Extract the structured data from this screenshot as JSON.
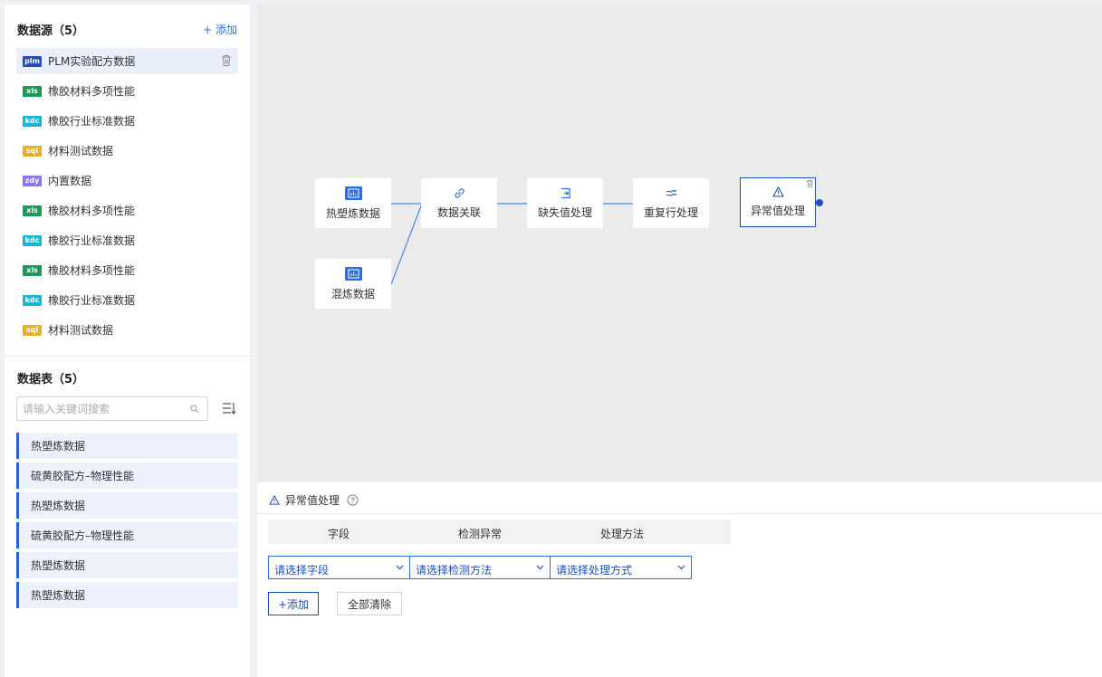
{
  "colors": {
    "accent": "#2a6fdb",
    "node_selected": "#1f4fb8",
    "badge_plm": "#1f4fb8",
    "badge_xls": "#1a9a55",
    "badge_kdc": "#1bb5d8",
    "badge_sql": "#e8b12c",
    "badge_zdy": "#8e74e8"
  },
  "datasource": {
    "title": "数据源（5）",
    "add_label": "+ 添加",
    "items": [
      {
        "badge": "plm",
        "label": "PLM实验配方数据"
      },
      {
        "badge": "xls",
        "label": "橡胶材料多项性能"
      },
      {
        "badge": "kdc",
        "label": "橡胶行业标准数据"
      },
      {
        "badge": "sql",
        "label": "材料测试数据"
      },
      {
        "badge": "zdy",
        "label": "内置数据"
      },
      {
        "badge": "xls",
        "label": "橡胶材料多项性能"
      },
      {
        "badge": "kdc",
        "label": "橡胶行业标准数据"
      },
      {
        "badge": "xls",
        "label": "橡胶材料多项性能"
      },
      {
        "badge": "kdc",
        "label": "橡胶行业标准数据"
      },
      {
        "badge": "sql",
        "label": "材料测试数据"
      }
    ]
  },
  "datatable": {
    "title": "数据表（5）",
    "search_placeholder": "请输入关键词搜索",
    "items": [
      "热塑炼数据",
      "硫黄胶配方–物理性能",
      "热塑炼数据",
      "硫黄胶配方–物理性能",
      "热塑炼数据",
      "热塑炼数据"
    ]
  },
  "flow": {
    "nodes": [
      {
        "label": "热塑炼数据",
        "icon": "chart-icon"
      },
      {
        "label": "混炼数据",
        "icon": "chart-icon"
      },
      {
        "label": "数据关联",
        "icon": "link-icon"
      },
      {
        "label": "缺失值处理",
        "icon": "import-icon"
      },
      {
        "label": "重复行处理",
        "icon": "approx-icon"
      },
      {
        "label": "异常值处理",
        "icon": "warning-icon"
      }
    ]
  },
  "config": {
    "title": "异常值处理",
    "columns": [
      "字段",
      "检测异常",
      "处理方法"
    ],
    "field_select": "请选择字段",
    "detect_select": "请选择检测方法",
    "method_select": "请选择处理方式",
    "add_button": "+添加",
    "clear_button": "全部清除"
  }
}
